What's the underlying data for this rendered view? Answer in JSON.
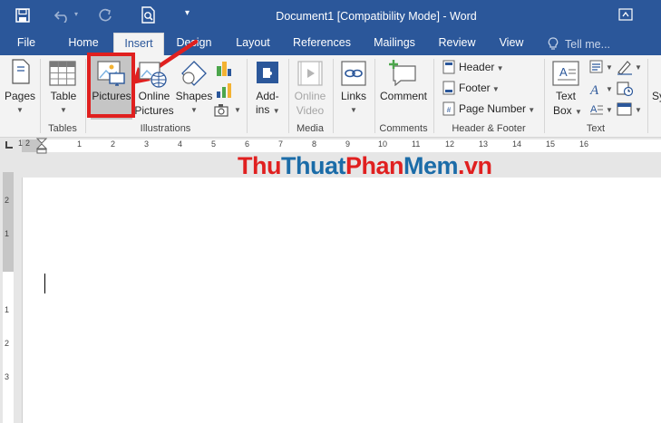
{
  "title_bar": {
    "document_title": "Document1 [Compatibility Mode] - Word"
  },
  "tabs": [
    {
      "label": "File"
    },
    {
      "label": "Home"
    },
    {
      "label": "Insert"
    },
    {
      "label": "Design"
    },
    {
      "label": "Layout"
    },
    {
      "label": "References"
    },
    {
      "label": "Mailings"
    },
    {
      "label": "Review"
    },
    {
      "label": "View"
    }
  ],
  "tell_me": {
    "placeholder": "Tell me..."
  },
  "ribbon": {
    "pages_label": "Pages",
    "table_label": "Table",
    "tables_group": "Tables",
    "pictures_label": "Pictures",
    "online_label": "Online",
    "online_label2": "Pictures",
    "shapes_label": "Shapes",
    "illustrations_group": "Illustrations",
    "addins_label": "Add-",
    "addins_label2": "ins",
    "online_video_label": "Online",
    "online_video_label2": "Video",
    "media_group": "Media",
    "links_label": "Links",
    "comment_label": "Comment",
    "comments_group": "Comments",
    "header_label": "Header",
    "footer_label": "Footer",
    "page_number_label": "Page Number",
    "header_footer_group": "Header & Footer",
    "textbox_label": "Text",
    "textbox_label2": "Box",
    "text_group": "Text",
    "symbols_cut": "Sy"
  },
  "ruler": {
    "h_ticks": [
      "1",
      "2",
      "1",
      "2",
      "3",
      "4",
      "5",
      "6",
      "7",
      "8",
      "9",
      "10",
      "11",
      "12",
      "13",
      "14",
      "15",
      "16"
    ],
    "v_ticks": [
      "2",
      "1",
      "1",
      "2",
      "3"
    ]
  },
  "watermark": {
    "part1": "Thu",
    "part2": "Thuat",
    "part3": "Phan",
    "part4": "Mem",
    "part5": ".vn"
  },
  "colors": {
    "word_blue": "#2b579a",
    "highlight_red": "#e0201f",
    "watermark_red": "#e02020",
    "watermark_blue": "#1b6ca8"
  }
}
